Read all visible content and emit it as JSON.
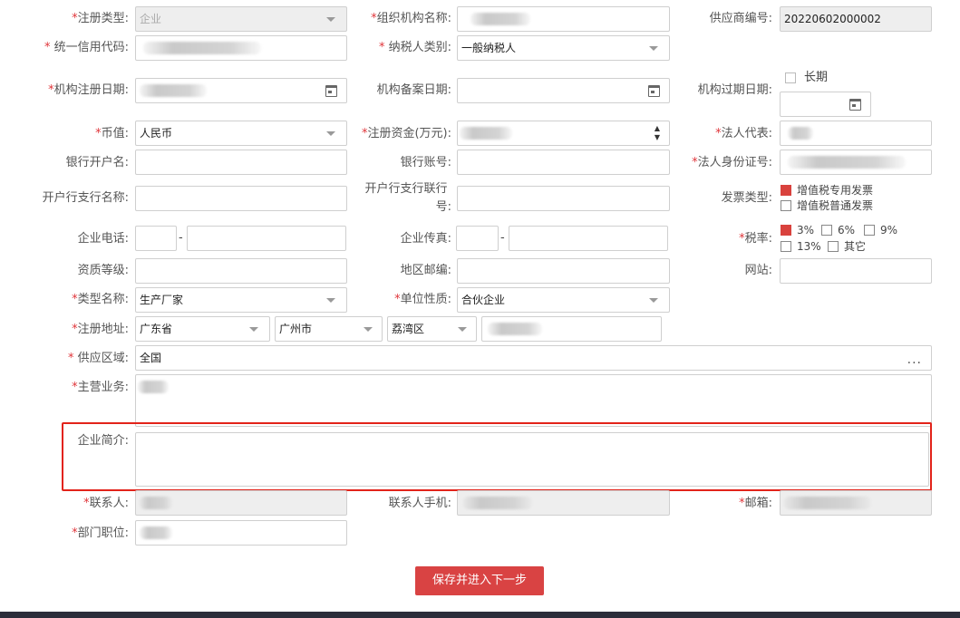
{
  "form": {
    "reg_type": {
      "label": "注册类型:",
      "value": "企业"
    },
    "org_name": {
      "label": "组织机构名称:"
    },
    "supplier_no": {
      "label": "供应商编号:",
      "value": "20220602000002"
    },
    "credit_code": {
      "label": "统一信用代码:"
    },
    "taxpayer_type": {
      "label": "纳税人类别:",
      "value": "一般纳税人"
    },
    "reg_date": {
      "label": "机构注册日期:"
    },
    "record_date": {
      "label": "机构备案日期:"
    },
    "expire_date": {
      "label": "机构过期日期:",
      "long_term": "长期"
    },
    "currency": {
      "label": "币值:",
      "value": "人民币"
    },
    "capital": {
      "label": "注册资金(万元):"
    },
    "legal_rep": {
      "label": "法人代表:"
    },
    "bank_account_name": {
      "label": "银行开户名:"
    },
    "bank_account_no": {
      "label": "银行账号:"
    },
    "legal_id": {
      "label": "法人身份证号:"
    },
    "bank_branch": {
      "label": "开户行支行名称:"
    },
    "bank_branch_no": {
      "label_line1": "开户行支行联行",
      "label_line2": "号:"
    },
    "invoice_type": {
      "label": "发票类型:",
      "options": [
        "增值税专用发票",
        "增值税普通发票"
      ]
    },
    "phone": {
      "label": "企业电话:",
      "sep": "-"
    },
    "fax": {
      "label": "企业传真:",
      "sep": "-"
    },
    "tax_rate": {
      "label": "税率:",
      "options": [
        "3%",
        "6%",
        "9%",
        "13%",
        "其它"
      ]
    },
    "qualification": {
      "label": "资质等级:"
    },
    "postcode": {
      "label": "地区邮编:"
    },
    "website": {
      "label": "网站:"
    },
    "type_name": {
      "label": "类型名称:",
      "value": "生产厂家"
    },
    "unit_nature": {
      "label": "单位性质:",
      "value": "合伙企业"
    },
    "address": {
      "label": "注册地址:",
      "province": "广东省",
      "city": "广州市",
      "district": "荔湾区"
    },
    "supply_area": {
      "label": "供应区域:",
      "value": "全国",
      "more": "···"
    },
    "main_business": {
      "label": "主营业务:"
    },
    "intro": {
      "label": "企业简介:"
    },
    "contact": {
      "label": "联系人:"
    },
    "contact_phone": {
      "label": "联系人手机:"
    },
    "email": {
      "label": "邮箱:"
    },
    "dept": {
      "label": "部门职位:"
    }
  },
  "actions": {
    "submit": "保存并进入下一步"
  },
  "colors": {
    "required": "#e0353a",
    "primary": "#d94343",
    "highlight": "#e2231a"
  }
}
